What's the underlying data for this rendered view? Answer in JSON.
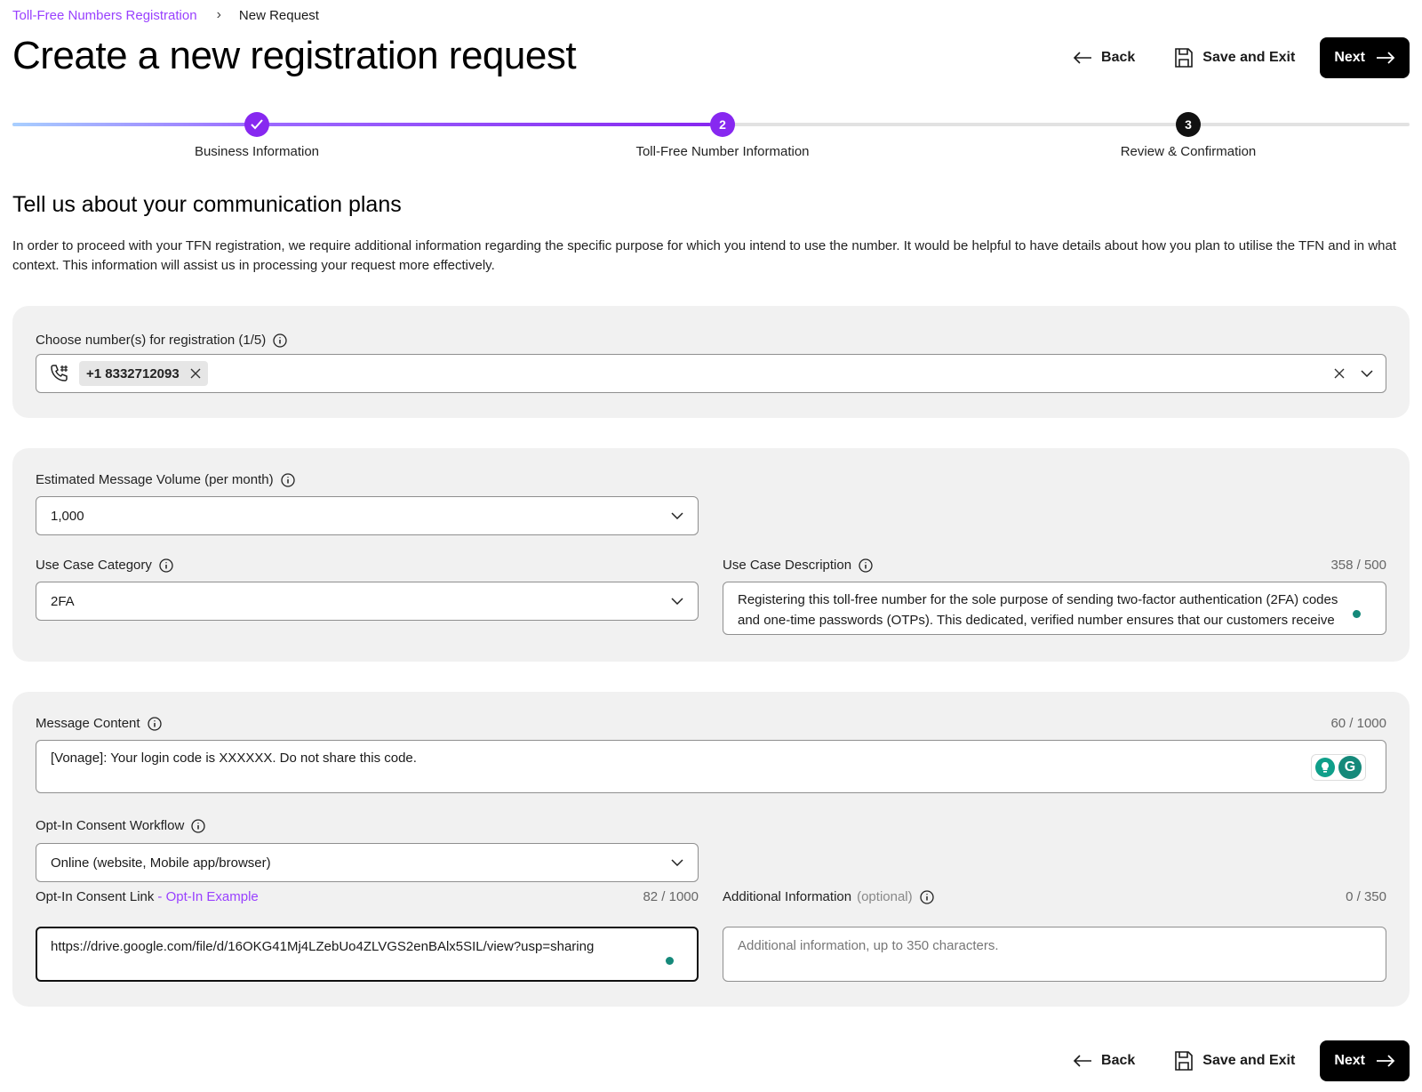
{
  "breadcrumb": {
    "parent": "Toll-Free Numbers Registration",
    "separator": "›",
    "current": "New Request"
  },
  "page_title": "Create a new registration request",
  "actions": {
    "back": "Back",
    "save_exit": "Save and Exit",
    "next": "Next"
  },
  "stepper": {
    "steps": [
      {
        "label": "Business Information",
        "status": "completed",
        "marker": "✓"
      },
      {
        "label": "Toll-Free Number Information",
        "status": "active",
        "marker": "2"
      },
      {
        "label": "Review & Confirmation",
        "status": "pending",
        "marker": "3"
      }
    ],
    "colors": {
      "accent": "#8728f0",
      "pending": "#111111",
      "track": "#e2e2e2"
    }
  },
  "section_title": "Tell us about your communication plans",
  "intro": "In order to proceed with your TFN registration, we require additional information regarding the specific purpose for which you intend to use the number. It would be helpful to have details about how you plan to utilise the TFN and in what context. This information will assist us in processing your request more effectively.",
  "numbers": {
    "label": "Choose number(s) for registration (1/5)",
    "icon": "phone-hash-icon",
    "selected": [
      "+1 8332712093"
    ]
  },
  "volume": {
    "label": "Estimated Message Volume (per month)",
    "value": "1,000"
  },
  "use_case_category": {
    "label": "Use Case Category",
    "value": "2FA"
  },
  "use_case_description": {
    "label": "Use Case Description",
    "counter": "358 / 500",
    "value": "Registering this toll-free number for the sole purpose of sending two-factor authentication (2FA) codes and one-time passwords (OTPs). This dedicated, verified number ensures that our customers receive secure, consistent, and recognizable verification messages for critical actions."
  },
  "message_content": {
    "label": "Message Content",
    "counter": "60 / 1000",
    "value": "[Vonage]: Your login code is XXXXXX. Do not share this code."
  },
  "optin_workflow": {
    "label": "Opt-In Consent Workflow",
    "value": "Online (website, Mobile app/browser)"
  },
  "optin_link": {
    "label": "Opt-In Consent Link",
    "example_link": "- Opt-In Example",
    "counter": "82 / 1000",
    "value": "https://drive.google.com/file/d/16OKG41Mj4LZebUo4ZLVGS2enBAlx5SIL/view?usp=sharing"
  },
  "additional_info": {
    "label": "Additional Information",
    "optional": "(optional)",
    "counter": "0 / 350",
    "placeholder": "Additional information, up to 350 characters."
  }
}
